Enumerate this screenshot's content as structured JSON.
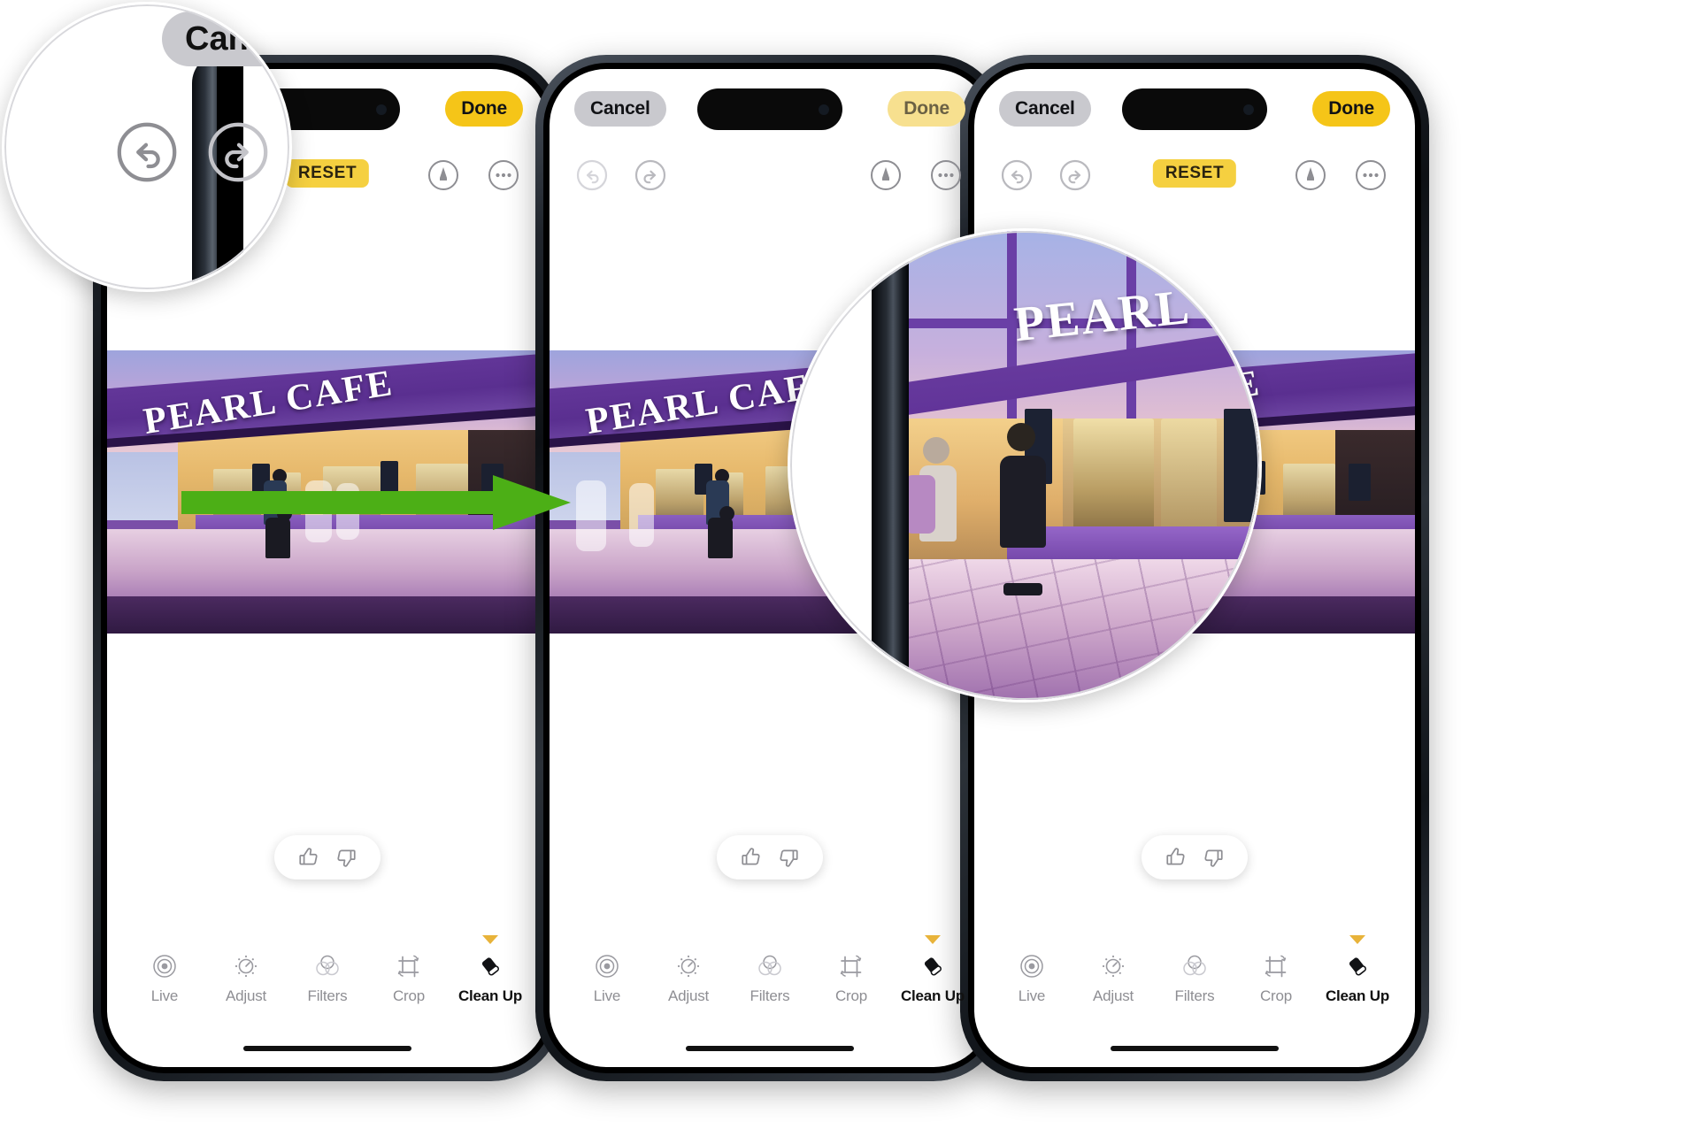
{
  "page": {
    "title": "iPhone Photos app Clean Up tool walkthrough",
    "background_color": "#ffffff",
    "accent_yellow": "#f5c518",
    "accent_green": "#4caf16",
    "cancel_gray": "#c9c9ce"
  },
  "arrow": {
    "name": "progress-arrow",
    "color": "#4caf16",
    "direction": "right"
  },
  "phones": [
    {
      "id": "phone-1",
      "topbar": {
        "cancel_label": "Cancel",
        "done_label": "Done",
        "done_state": "enabled"
      },
      "tools": {
        "undo_icon": "undo-arrow-circle-icon",
        "redo_icon": "redo-arrow-circle-icon",
        "reset_label": "RESET",
        "reset_visible": true,
        "markup_icon": "markup-pen-circle-icon",
        "more_icon": "more-ellipsis-circle-icon"
      },
      "photo": {
        "sign_text": "PEARL CAFE",
        "alt": "Purple-lit cruise ship cafe interior with people walking"
      },
      "feedback": {
        "thumbs_up_icon": "thumbs-up-icon",
        "thumbs_down_icon": "thumbs-down-icon"
      },
      "tabs": [
        {
          "label": "Live",
          "icon": "live-photo-icon",
          "active": false
        },
        {
          "label": "Adjust",
          "icon": "adjust-dial-icon",
          "active": false
        },
        {
          "label": "Filters",
          "icon": "filters-circles-icon",
          "active": false
        },
        {
          "label": "Crop",
          "icon": "crop-frame-icon",
          "active": false
        },
        {
          "label": "Clean Up",
          "icon": "clean-up-eraser-icon",
          "active": true
        }
      ]
    },
    {
      "id": "phone-2",
      "topbar": {
        "cancel_label": "Cancel",
        "done_label": "Done",
        "done_state": "dimmed"
      },
      "tools": {
        "undo_icon": "undo-arrow-circle-icon",
        "redo_icon": "redo-arrow-circle-icon",
        "reset_label": "RESET",
        "reset_visible": false,
        "markup_icon": "markup-pen-circle-icon",
        "more_icon": "more-ellipsis-circle-icon"
      },
      "photo": {
        "sign_text": "PEARL CAFE",
        "alt": "Same cafe photo after Clean Up removed a person"
      },
      "feedback": {
        "thumbs_up_icon": "thumbs-up-icon",
        "thumbs_down_icon": "thumbs-down-icon"
      },
      "tabs": [
        {
          "label": "Live",
          "icon": "live-photo-icon",
          "active": false
        },
        {
          "label": "Adjust",
          "icon": "adjust-dial-icon",
          "active": false
        },
        {
          "label": "Filters",
          "icon": "filters-circles-icon",
          "active": false
        },
        {
          "label": "Crop",
          "icon": "crop-frame-icon",
          "active": false
        },
        {
          "label": "Clean Up",
          "icon": "clean-up-eraser-icon",
          "active": true
        }
      ]
    },
    {
      "id": "phone-3",
      "topbar": {
        "cancel_label": "Cancel",
        "done_label": "Done",
        "done_state": "enabled"
      },
      "tools": {
        "undo_icon": "undo-arrow-circle-icon",
        "redo_icon": "redo-arrow-circle-icon",
        "reset_label": "RESET",
        "reset_visible": true,
        "markup_icon": "markup-pen-circle-icon",
        "more_icon": "more-ellipsis-circle-icon"
      },
      "photo": {
        "sign_text": "PEARL CAFE",
        "alt": "Cafe photo restored after pressing RESET"
      },
      "feedback": {
        "thumbs_up_icon": "thumbs-up-icon",
        "thumbs_down_icon": "thumbs-down-icon"
      },
      "tabs": [
        {
          "label": "Live",
          "icon": "live-photo-icon",
          "active": false
        },
        {
          "label": "Adjust",
          "icon": "adjust-dial-icon",
          "active": false
        },
        {
          "label": "Filters",
          "icon": "filters-circles-icon",
          "active": false
        },
        {
          "label": "Crop",
          "icon": "crop-frame-icon",
          "active": false
        },
        {
          "label": "Clean Up",
          "icon": "clean-up-eraser-icon",
          "active": true
        }
      ]
    }
  ],
  "magnifiers": [
    {
      "id": "magnifier-top-left",
      "caption": "Cancel",
      "shows": "undo and redo buttons in the editor toolbar",
      "undo_icon": "undo-arrow-circle-icon",
      "redo_icon": "redo-arrow-circle-icon"
    },
    {
      "id": "magnifier-photo-zoom",
      "caption": "PEARL",
      "shows": "zoomed detail of the restored photo with the person back in frame"
    }
  ]
}
